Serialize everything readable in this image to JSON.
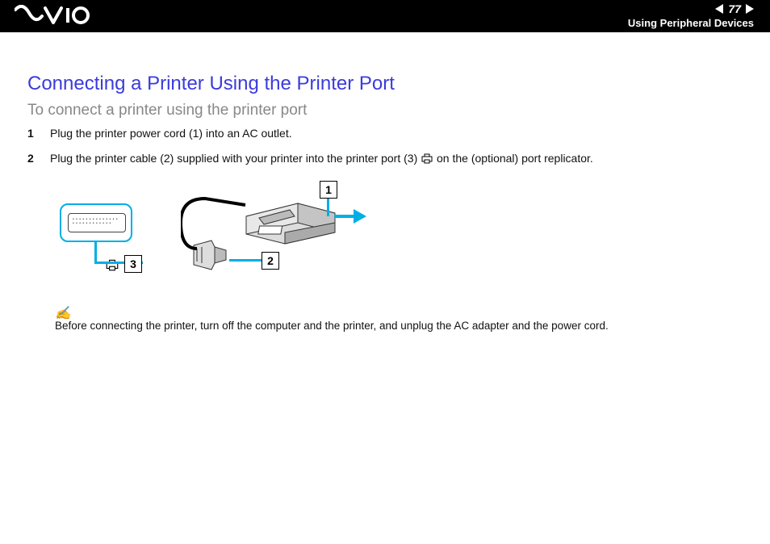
{
  "header": {
    "page_number": "77",
    "section": "Using Peripheral Devices",
    "logo_alt": "VAIO"
  },
  "title": "Connecting a Printer Using the Printer Port",
  "subtitle": "To connect a printer using the printer port",
  "steps": [
    {
      "num": "1",
      "text": "Plug the printer power cord (1) into an AC outlet."
    },
    {
      "num": "2",
      "text_before": "Plug the printer cable (2) supplied with your printer into the printer port (3) ",
      "text_after": " on the (optional) port replicator."
    }
  ],
  "diagram": {
    "callouts": {
      "c1": "1",
      "c2": "2",
      "c3": "3"
    },
    "port_dots": "• • • • • • • • • • • • • • • • • • • • • • • • • •"
  },
  "note": {
    "icon": "✍",
    "text": "Before connecting the printer, turn off the computer and the printer, and unplug the AC adapter and the power cord."
  }
}
